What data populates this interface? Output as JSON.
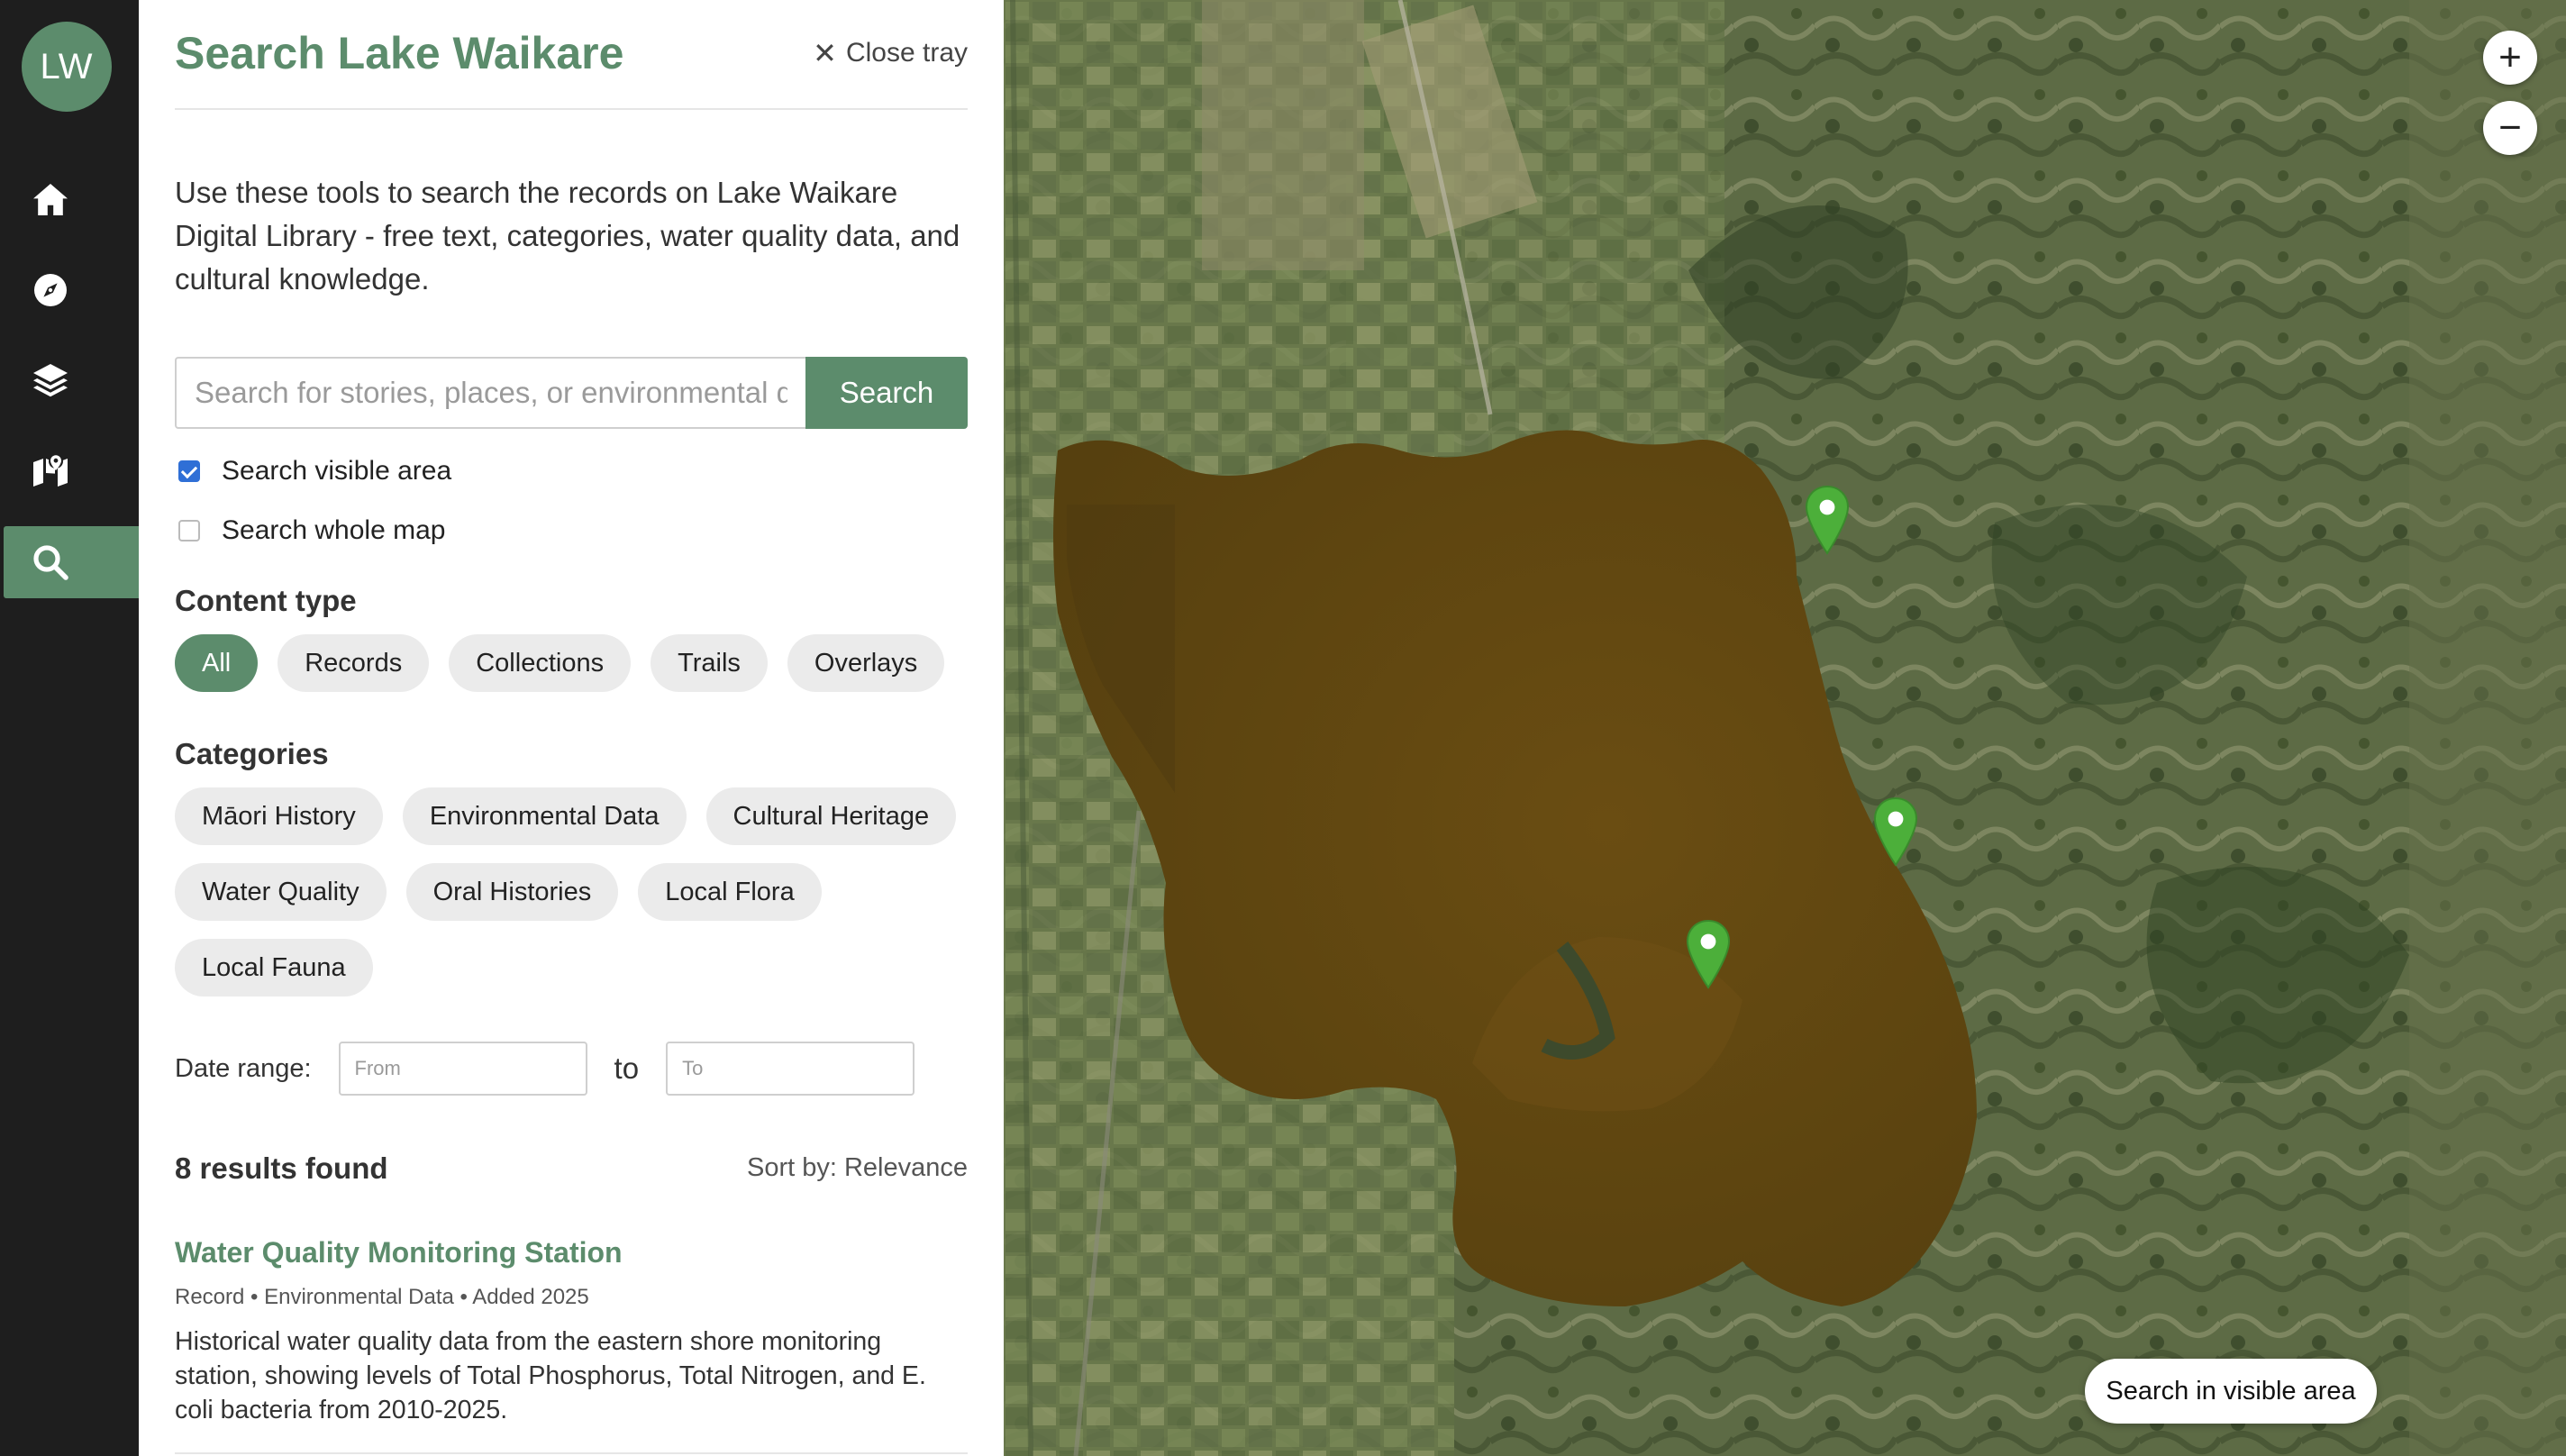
{
  "rail": {
    "logo_text": "LW",
    "items": [
      {
        "icon": "home-icon"
      },
      {
        "icon": "compass-icon"
      },
      {
        "icon": "layers-icon"
      },
      {
        "icon": "map-icon"
      },
      {
        "icon": "search-icon",
        "active": true
      }
    ],
    "accent_color": "#5c8c6c"
  },
  "tray": {
    "title": "Search Lake Waikare",
    "close_label": "Close tray",
    "intro": "Use these tools to search the records on Lake Waikare Digital Library - free text, categories, water quality data, and cultural knowledge.",
    "search": {
      "placeholder": "Search for stories, places, or environmental data",
      "value": "",
      "button_label": "Search"
    },
    "scope": [
      {
        "label": "Search visible area",
        "checked": true
      },
      {
        "label": "Search whole map",
        "checked": false
      }
    ],
    "content_type": {
      "heading": "Content type",
      "options": [
        "All",
        "Records",
        "Collections",
        "Trails",
        "Overlays"
      ],
      "selected": "All"
    },
    "categories": {
      "heading": "Categories",
      "options": [
        "Māori History",
        "Environmental Data",
        "Cultural Heritage",
        "Water Quality",
        "Oral Histories",
        "Local Flora",
        "Local Fauna"
      ]
    },
    "date_range": {
      "label": "Date range:",
      "from_placeholder": "From",
      "to_label": "to",
      "to_placeholder": "To"
    },
    "results": {
      "count_label": "8 results found",
      "sort_label": "Sort by: Relevance",
      "items": [
        {
          "title": "Water Quality Monitoring Station",
          "meta": "Record • Environmental Data • Added 2025",
          "description": "Historical water quality data from the eastern shore monitoring station, showing levels of Total Phosphorus, Total Nitrogen, and E. coli bacteria from 2010-2025."
        }
      ]
    }
  },
  "map": {
    "zoom_in_label": "+",
    "zoom_out_label": "−",
    "search_visible_label": "Search in visible area",
    "pin_color": "#4caf3a"
  }
}
